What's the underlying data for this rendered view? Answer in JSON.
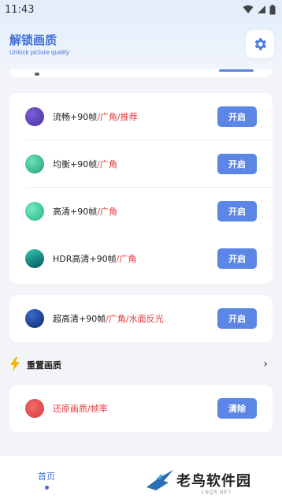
{
  "status": {
    "time": "11:43"
  },
  "header": {
    "title": "解锁画质",
    "subtitle": "Unlock picture quality",
    "settings_icon": "gear-icon"
  },
  "card1": {
    "rows": [
      {
        "label": "流畅+90帧",
        "tag": "/广角/推荐",
        "button": "开启",
        "color": "#5b3fb8"
      },
      {
        "label": "均衡+90帧",
        "tag": "/广角",
        "button": "开启",
        "color": "#27b88a"
      },
      {
        "label": "高清+90帧",
        "tag": "/广角",
        "button": "开启",
        "color": "#2bbf8f"
      },
      {
        "label": "HDR高清+90帧",
        "tag": "/广角",
        "button": "开启",
        "color": "#1a8f86"
      }
    ]
  },
  "card2": {
    "rows": [
      {
        "label": "超高清+90帧",
        "tag": "/广角/水面反光",
        "button": "开启",
        "color": "#15357a"
      }
    ]
  },
  "reset": {
    "title": "重置画质",
    "row": {
      "label": "还原画质/帧率",
      "button": "清除",
      "color": "#e14a4a"
    }
  },
  "nav": {
    "home": "首页"
  },
  "watermark": {
    "name": "老鸟软件园",
    "domain": "LNQS.NET"
  },
  "colors": {
    "accent": "#5b86e5",
    "tag_red": "#e4393c",
    "title_blue": "#3f6fd8"
  }
}
